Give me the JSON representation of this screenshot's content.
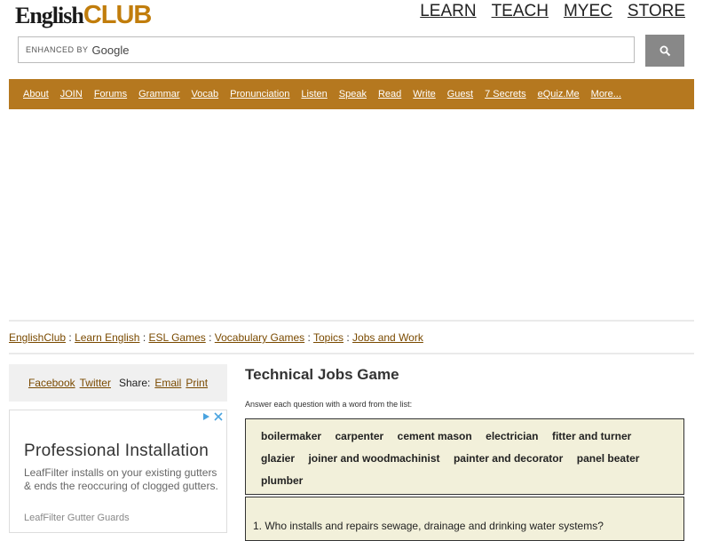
{
  "logo": {
    "part1": "English",
    "part2": "CLUB"
  },
  "top_nav": [
    "LEARN",
    "TEACH",
    "MYEC",
    "STORE"
  ],
  "search": {
    "enhanced_label": "ENHANCED BY",
    "brand": "Google",
    "button_icon": "search-icon"
  },
  "main_nav": [
    "About",
    "JOIN",
    "Forums",
    "Grammar",
    "Vocab",
    "Pronunciation",
    "Listen",
    "Speak",
    "Read",
    "Write",
    "Guest",
    "7 Secrets",
    "eQuiz.Me",
    "More..."
  ],
  "breadcrumb": {
    "items": [
      "EnglishClub",
      "Learn English",
      "ESL Games",
      "Vocabulary Games",
      "Topics",
      "Jobs and Work"
    ],
    "separator": ":"
  },
  "share": {
    "facebook": "Facebook",
    "twitter": "Twitter",
    "label": "Share:",
    "email": "Email",
    "print": "Print"
  },
  "ad": {
    "title": "Professional Installation",
    "body": "LeafFilter installs on your existing gutters & ends the reoccuring of clogged gutters.",
    "source": "LeafFilter Gutter Guards"
  },
  "game": {
    "title": "Technical Jobs Game",
    "instructions": "Answer each question with a word from the list:",
    "words": [
      "boilermaker",
      "carpenter",
      "cement mason",
      "electrician",
      "fitter and turner",
      "glazier",
      "joiner and woodmachinist",
      "painter and decorator",
      "panel beater",
      "plumber"
    ],
    "first_question": "1. Who installs and repairs sewage, drainage and drinking water systems?"
  },
  "colors": {
    "nav_bar": "#b5781f",
    "logo_accent": "#c17d0c",
    "word_box": "#f2f0da",
    "link": "#7a4a00"
  }
}
